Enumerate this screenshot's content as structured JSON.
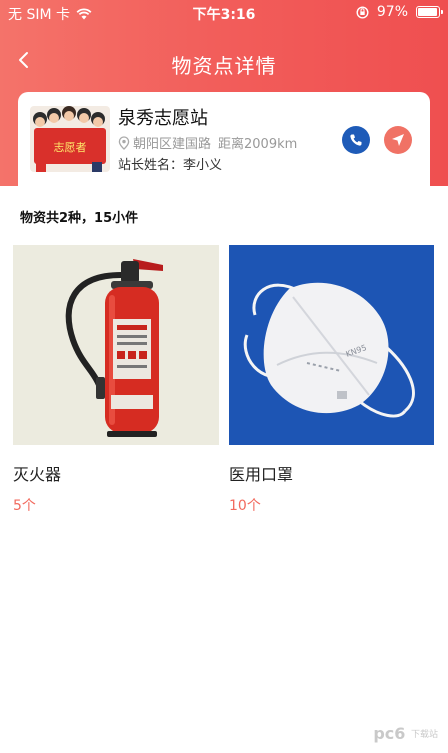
{
  "status_bar": {
    "carrier": "无 SIM 卡",
    "time": "下午3:16",
    "battery": "97%",
    "battery_level": 0.97,
    "icons": [
      "wifi-icon",
      "rotation-lock-icon",
      "battery-icon"
    ]
  },
  "nav": {
    "title": "物资点详情",
    "back_icon": "chevron-left-icon"
  },
  "station": {
    "name": "泉秀志愿站",
    "address": "朝阳区建国路",
    "distance": "距离2009km",
    "manager": "站长姓名：李小义",
    "banner_text": "志愿者"
  },
  "summary": "物资共2种，15小件",
  "items": [
    {
      "name": "灭火器",
      "quantity": "5个",
      "image": "fire-extinguisher"
    },
    {
      "name": "医用口罩",
      "quantity": "10个",
      "image": "face-mask",
      "mask_print": "KN95"
    }
  ],
  "watermark": {
    "main": "pc6",
    "sub": "下载站"
  },
  "colors": {
    "header_gradient_start": "#f4736a",
    "header_gradient_end": "#ef4f50",
    "call_button": "#1e5bb8",
    "nav_button": "#f07265",
    "quantity_text": "#f26a5e"
  }
}
